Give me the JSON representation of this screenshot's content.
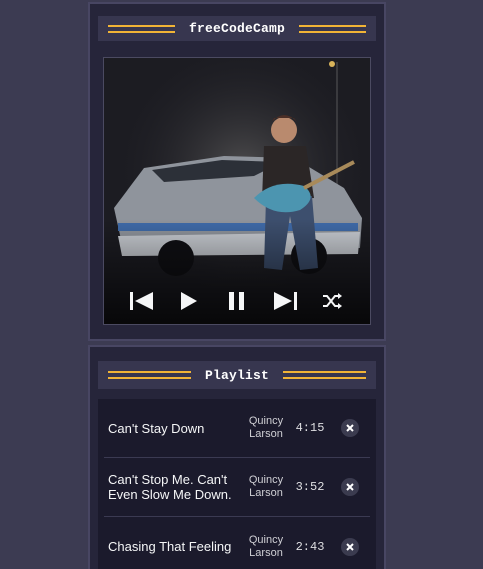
{
  "player": {
    "title": "freeCodeCamp",
    "controls": [
      {
        "name": "previous-button",
        "icon": "skip-previous-icon"
      },
      {
        "name": "play-button",
        "icon": "play-icon"
      },
      {
        "name": "pause-button",
        "icon": "pause-icon"
      },
      {
        "name": "next-button",
        "icon": "skip-next-icon"
      },
      {
        "name": "shuffle-button",
        "icon": "shuffle-icon"
      }
    ]
  },
  "playlist": {
    "title": "Playlist",
    "songs": [
      {
        "title": "Can't Stay Down",
        "artist": "Quincy Larson",
        "duration": "4:15"
      },
      {
        "title": "Can't Stop Me. Can't Even Slow Me Down.",
        "artist": "Quincy Larson",
        "duration": "3:52"
      },
      {
        "title": "Chasing That Feeling",
        "artist": "Quincy Larson",
        "duration": "2:43"
      }
    ]
  },
  "colors": {
    "background": "#3c3b52",
    "panel": "#26253a",
    "accent_stripe": "#f1b436",
    "text": "#ffffff"
  }
}
